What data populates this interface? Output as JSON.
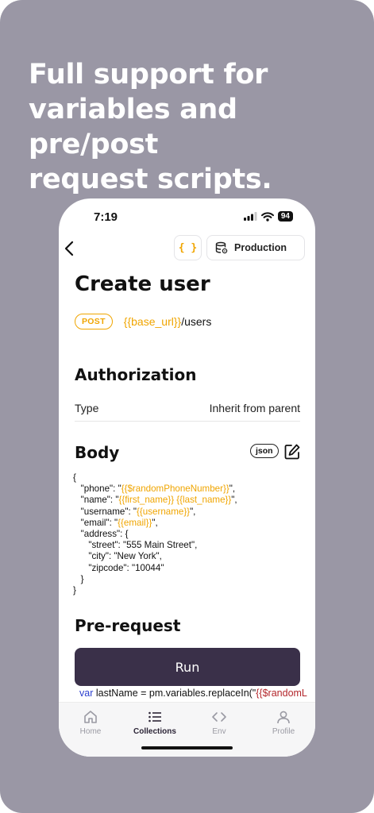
{
  "headline": {
    "line1": "Full support for",
    "line2": "variables and pre/post",
    "line3": "request scripts."
  },
  "status_bar": {
    "time": "7:19",
    "battery": "94"
  },
  "navbar": {
    "variables_label": "{ }",
    "environment_label": "Production"
  },
  "request": {
    "title": "Create user",
    "method": "POST",
    "url_variable": "{{base_url}}",
    "url_path": "/users"
  },
  "authorization": {
    "title": "Authorization",
    "type_label": "Type",
    "type_value": "Inherit from parent"
  },
  "body": {
    "title": "Body",
    "format_badge": "json",
    "lines": [
      {
        "pre": "{",
        "var": "",
        "post": ""
      },
      {
        "pre": "   \"phone\": \"",
        "var": "{{$randomPhoneNumber}}",
        "post": "\","
      },
      {
        "pre": "   \"name\": \"",
        "var": "{{first_name}} {{last_name}}",
        "post": "\","
      },
      {
        "pre": "   \"username\": \"",
        "var": "{{username}}",
        "post": "\","
      },
      {
        "pre": "   \"email\": \"",
        "var": "{{email}}",
        "post": "\","
      },
      {
        "pre": "   \"address\": {",
        "var": "",
        "post": ""
      },
      {
        "pre": "      \"street\": \"555 Main Street\",",
        "var": "",
        "post": ""
      },
      {
        "pre": "      \"city\": \"New York\",",
        "var": "",
        "post": ""
      },
      {
        "pre": "      \"zipcode\": \"10044\"",
        "var": "",
        "post": ""
      },
      {
        "pre": "   }",
        "var": "",
        "post": ""
      },
      {
        "pre": "}",
        "var": "",
        "post": ""
      }
    ]
  },
  "pre_request": {
    "title": "Pre-request",
    "run_label": "Run",
    "script_keyword": "var",
    "script_code": " lastName = pm.variables.replaceIn(\"",
    "script_string": "{{$randomL"
  },
  "tabs": [
    {
      "label": "Home",
      "icon": "home-icon",
      "active": false
    },
    {
      "label": "Collections",
      "icon": "list-icon",
      "active": true
    },
    {
      "label": "Env",
      "icon": "code-icon",
      "active": false
    },
    {
      "label": "Profile",
      "icon": "person-icon",
      "active": false
    }
  ],
  "colors": {
    "background": "#9a97a5",
    "accent_variable": "#f0a500",
    "run_button": "#3a3049",
    "keyword": "#2b3fcf",
    "string": "#b3262b"
  }
}
